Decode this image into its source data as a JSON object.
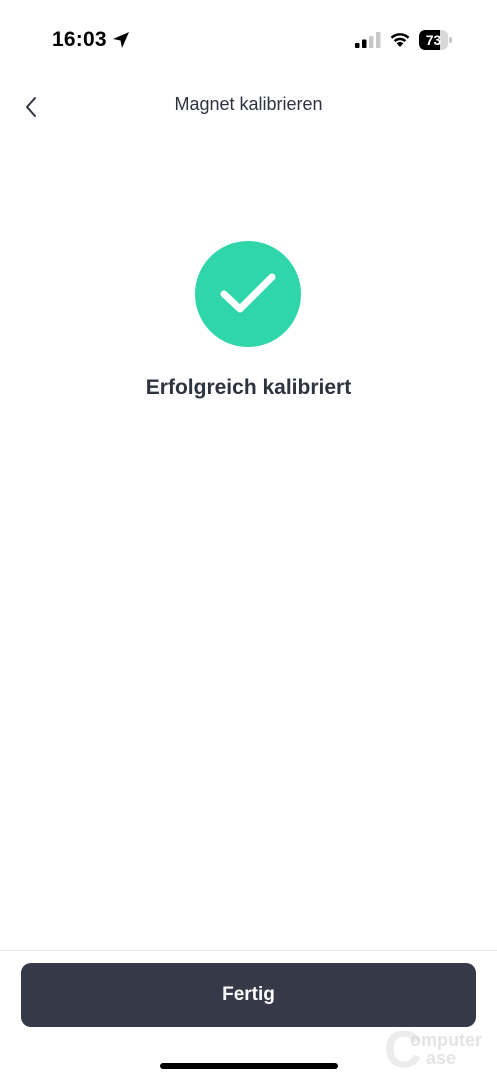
{
  "status_bar": {
    "time": "16:03",
    "location_icon": "location-arrow-icon",
    "signal_icon": "cellular-signal-icon",
    "wifi_icon": "wifi-icon",
    "battery_level": "73",
    "battery_fraction": 0.73
  },
  "nav": {
    "back_icon": "chevron-left-icon",
    "title": "Magnet kalibrieren"
  },
  "success": {
    "icon": "checkmark-icon",
    "message": "Erfolgreich kalibriert"
  },
  "footer": {
    "done_label": "Fertig"
  },
  "watermark": {
    "line1": "omputer",
    "line2": "ase"
  },
  "colors": {
    "success_green": "#2fd6aa",
    "button_dark": "#363a48",
    "text_dark": "#2e3340"
  }
}
